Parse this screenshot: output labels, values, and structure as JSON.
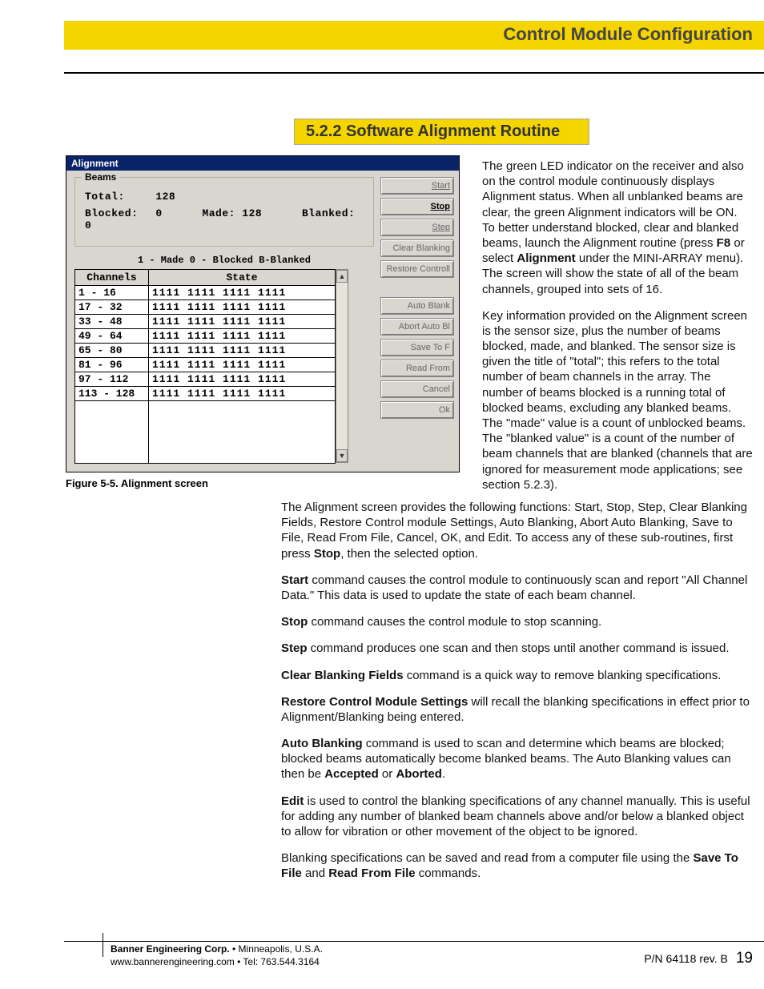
{
  "header": {
    "chapter_title": "Control Module Configuration",
    "section_number": "5.2.2 Software Alignment Routine"
  },
  "window": {
    "title": "Alignment",
    "beams": {
      "legend": "Beams",
      "total_label": "Total:",
      "total_value": "128",
      "blocked_label": "Blocked:",
      "blocked_value": "0",
      "made_label": "Made:",
      "made_value": "128",
      "blanked_label": "Blanked:",
      "blanked_value": "0"
    },
    "legend_line": "1 - Made    0 - Blocked    B-Blanked",
    "columns": {
      "channels": "Channels",
      "state": "State"
    },
    "rows": [
      {
        "ch": "1  - 16",
        "st": "1111 1111 1111 1111"
      },
      {
        "ch": "17 - 32",
        "st": "1111 1111 1111 1111"
      },
      {
        "ch": "33 - 48",
        "st": "1111 1111 1111 1111"
      },
      {
        "ch": "49 - 64",
        "st": "1111 1111 1111 1111"
      },
      {
        "ch": "65 - 80",
        "st": "1111 1111 1111 1111"
      },
      {
        "ch": "81 - 96",
        "st": "1111 1111 1111 1111"
      },
      {
        "ch": "97 - 112",
        "st": "1111 1111 1111 1111"
      },
      {
        "ch": "113 - 128",
        "st": "1111 1111 1111 1111"
      }
    ],
    "buttons": {
      "start": "Start",
      "stop": "Stop",
      "step": "Step",
      "clear_blanking": "Clear Blanking",
      "restore_controll": "Restore Controll",
      "auto_blank": "Auto Blank",
      "abort_auto_b": "Abort Auto Bl",
      "save_to_f": "Save To F",
      "read_from": "Read From",
      "cancel": "Cancel",
      "ok": "Ok"
    }
  },
  "figure_caption": "Figure 5-5.  Alignment screen",
  "paras": {
    "r1_a": "The green LED indicator on the receiver and also on the control module continuously displays Alignment status. When all unblanked beams are clear, the green Alignment indicators will be ON. To better understand blocked, clear and blanked beams, launch the Alignment routine (press ",
    "r1_b": "F8",
    "r1_c": " or select ",
    "r1_d": "Alignment",
    "r1_e": " under the MINI-ARRAY menu). The screen will show the state of all of the beam channels, grouped into sets of 16.",
    "r2": "Key information provided on the Alignment screen is the sensor size, plus the number of beams blocked, made, and blanked. The sensor size is given the title of \"total\"; this refers to the total number of beam channels in the array. The number of beams blocked is a running total of blocked beams, excluding any blanked beams. The \"made\" value is a count of unblocked beams. The \"blanked value\" is a count of the number of beam channels that are blanked (channels that are ignored for measurement mode applications; see section 5.2.3).",
    "l1_a": "The Alignment screen provides the following functions: Start, Stop, Step, Clear Blanking Fields, Restore Control module Settings, Auto Blanking, Abort Auto Blanking, Save to File, Read From File, Cancel, OK, and Edit. To access any of these sub-routines, first press ",
    "l1_b": "Stop",
    "l1_c": ", then the selected option.",
    "l2_a": "Start",
    "l2_b": " command causes the control module to continuously scan and report \"All Channel Data.\" This data is used to update the state of each beam channel.",
    "l3_a": "Stop",
    "l3_b": " command causes the control module to stop scanning.",
    "l4_a": "Step",
    "l4_b": " command produces one scan and then stops until another command is issued.",
    "l5_a": "Clear Blanking Fields",
    "l5_b": " command is a quick way to remove blanking specifications.",
    "l6_a": "Restore Control Module Settings",
    "l6_b": " will recall the blanking specifications in effect prior to Alignment/Blanking being entered.",
    "l7_a": "Auto Blanking",
    "l7_b": " command is used to scan and determine which beams are blocked; blocked beams automatically become blanked beams. The Auto Blanking values can then be ",
    "l7_c": "Accepted",
    "l7_d": " or ",
    "l7_e": "Aborted",
    "l7_f": ".",
    "l8_a": "Edit",
    "l8_b": " is used to control the blanking specifications of any channel manually. This is useful for adding any number of blanked beam channels above and/or below a blanked object to allow for vibration or other movement of the object to be ignored.",
    "l9_a": "Blanking specifications can be saved and read from a computer file using the ",
    "l9_b": "Save To File",
    "l9_c": " and ",
    "l9_d": "Read From File",
    "l9_e": " commands."
  },
  "footer": {
    "company": "Banner Engineering Corp.",
    "loc": " • Minneapolis, U.S.A.",
    "web": "www.bannerengineering.com  •  Tel: 763.544.3164",
    "pn": "P/N 64118 rev. B",
    "page": "19"
  }
}
